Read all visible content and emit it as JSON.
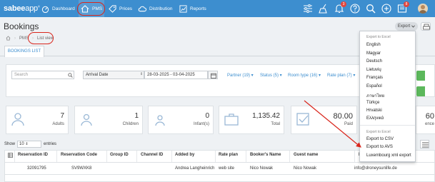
{
  "colors": {
    "nav_bg": "#3d8ecf",
    "accent": "#3d8ecf",
    "highlight_red": "#d9261c",
    "green": "#5cb85c",
    "badge_red": "#e2463d"
  },
  "nav": {
    "logo": "sabee",
    "logo_suffix": "app",
    "logo_mark": "®",
    "items": [
      {
        "label": "Dashboard",
        "icon": "dashboard-icon"
      },
      {
        "label": "PMS",
        "icon": "home-icon"
      },
      {
        "label": "Prices",
        "icon": "tag-icon"
      },
      {
        "label": "Distribution",
        "icon": "cloud-icon"
      },
      {
        "label": "Reports",
        "icon": "chart-icon"
      }
    ],
    "notification_badge": "3",
    "inbox_badge": "8"
  },
  "header": {
    "title": "Bookings",
    "breadcrumb": [
      "PMS",
      "List view"
    ],
    "export_label": "Export",
    "tab": "BOOKINGS LIST"
  },
  "filters": {
    "search_placeholder": "Search",
    "date_type": "Arrival Date",
    "date_range": "28-03-2025 - 03-04-2025",
    "chips": [
      "Partner (19)",
      "Status (5)",
      "Room type (16)",
      "Rate plan (7)"
    ]
  },
  "stats": [
    {
      "value": "7",
      "label": "Adults"
    },
    {
      "value": "1",
      "label": "Children"
    },
    {
      "value": "0",
      "label": "Infant(s)"
    },
    {
      "value": "1,135.42",
      "label": "Total"
    },
    {
      "value": "80.00",
      "label": "Paid"
    },
    {
      "value": "60",
      "label": "ence"
    }
  ],
  "table_controls": {
    "show_label": "Show",
    "show_value": "10",
    "entries_label": "entries"
  },
  "table": {
    "headers": [
      "Reservation ID",
      "Reservation Code",
      "Group ID",
      "Channel ID",
      "Added by",
      "Rate plan",
      "Booker's Name",
      "Guest name",
      "B"
    ],
    "rows": [
      [
        "32091795",
        "SV9WXK8",
        "",
        "",
        "Andrea Langheinrich",
        "web site",
        "Nico Nowak",
        "Nico Nowak",
        "info@droneysunlife.de"
      ]
    ]
  },
  "export_menu": {
    "excel_header": "Export to Excel",
    "languages": [
      "English",
      "Magyar",
      "Deutsch",
      "Lietuvių",
      "Français",
      "Español",
      "ภาษาไทย",
      "Türkçe",
      "Hrvatski",
      "Ελληνικά"
    ],
    "other_header": "Export to Excel",
    "options": [
      "Export to CSV",
      "Export to AVS",
      "Luxembourg xml export"
    ]
  }
}
